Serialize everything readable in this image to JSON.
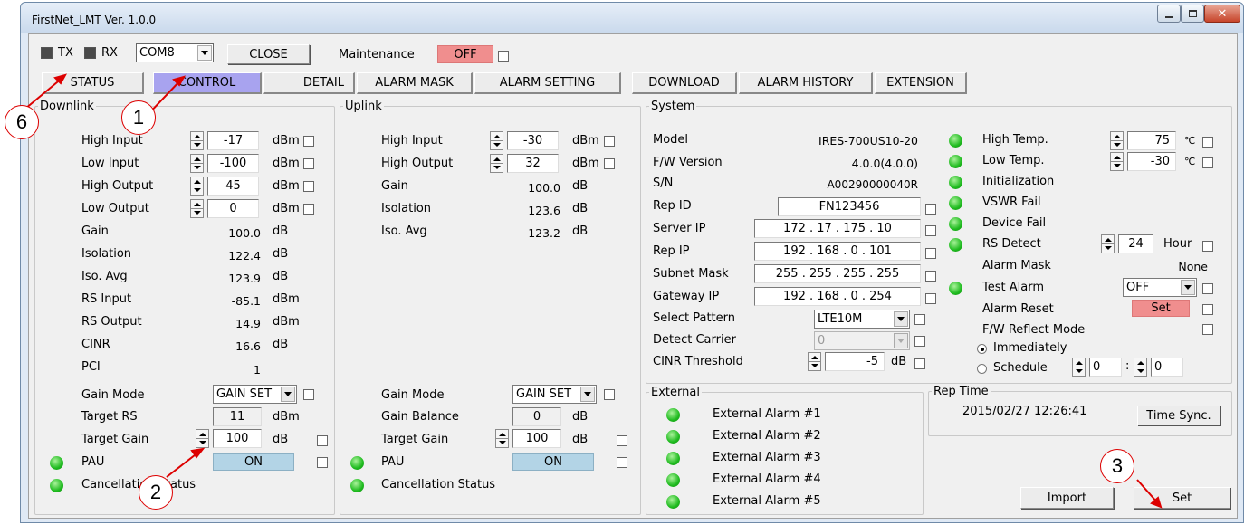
{
  "window": {
    "title": "FirstNet_LMT Ver. 1.0.0"
  },
  "toolbar": {
    "tx": "TX",
    "rx": "RX",
    "com_port": "COM8",
    "close_label": "CLOSE",
    "maintenance_label": "Maintenance",
    "maintenance_state": "OFF"
  },
  "tabs": [
    {
      "label": "STATUS"
    },
    {
      "label": "CONTROL"
    },
    {
      "label": "DETAIL"
    },
    {
      "label": "ALARM MASK"
    },
    {
      "label": "ALARM SETTING"
    },
    {
      "label": "DOWNLOAD"
    },
    {
      "label": "ALARM HISTORY"
    },
    {
      "label": "EXTENSION"
    }
  ],
  "downlink": {
    "title": "Downlink",
    "rows": [
      {
        "label": "High Input",
        "value": "-17",
        "unit": "dBm"
      },
      {
        "label": "Low Input",
        "value": "-100",
        "unit": "dBm"
      },
      {
        "label": "High Output",
        "value": "45",
        "unit": "dBm"
      },
      {
        "label": "Low Output",
        "value": "0",
        "unit": "dBm"
      }
    ],
    "readings": [
      {
        "label": "Gain",
        "value": "100.0",
        "unit": "dB"
      },
      {
        "label": "Isolation",
        "value": "122.4",
        "unit": "dB"
      },
      {
        "label": "Iso. Avg",
        "value": "123.9",
        "unit": "dB"
      },
      {
        "label": "RS Input",
        "value": "-85.1",
        "unit": "dBm"
      },
      {
        "label": "RS Output",
        "value": "14.9",
        "unit": "dBm"
      },
      {
        "label": "CINR",
        "value": "16.6",
        "unit": "dB"
      },
      {
        "label": "PCI",
        "value": "1",
        "unit": ""
      }
    ],
    "gain_mode_label": "Gain Mode",
    "gain_mode": "GAIN SET",
    "target_rs_label": "Target RS",
    "target_rs": "11",
    "target_rs_unit": "dBm",
    "target_gain_label": "Target Gain",
    "target_gain": "100",
    "target_gain_unit": "dB",
    "pau_label": "PAU",
    "pau_state": "ON",
    "cancellation_label": "Cancellation Status"
  },
  "uplink": {
    "title": "Uplink",
    "rows": [
      {
        "label": "High Input",
        "value": "-30",
        "unit": "dBm"
      },
      {
        "label": "High Output",
        "value": "32",
        "unit": "dBm"
      }
    ],
    "readings": [
      {
        "label": "Gain",
        "value": "100.0",
        "unit": "dB"
      },
      {
        "label": "Isolation",
        "value": "123.6",
        "unit": "dB"
      },
      {
        "label": "Iso. Avg",
        "value": "123.2",
        "unit": "dB"
      }
    ],
    "gain_mode_label": "Gain Mode",
    "gain_mode": "GAIN SET",
    "gain_balance_label": "Gain Balance",
    "gain_balance": "0",
    "gain_balance_unit": "dB",
    "target_gain_label": "Target Gain",
    "target_gain": "100",
    "target_gain_unit": "dB",
    "pau_label": "PAU",
    "pau_state": "ON",
    "cancellation_label": "Cancellation Status"
  },
  "system": {
    "title": "System",
    "model_label": "Model",
    "model": "IRES-700US10-20",
    "fw_label": "F/W Version",
    "fw": "4.0.0(4.0.0)",
    "sn_label": "S/N",
    "sn": "A00290000040R",
    "repid_label": "Rep ID",
    "repid": "FN123456",
    "server_ip_label": "Server IP",
    "server_ip": "172 . 17 . 175 . 10",
    "rep_ip_label": "Rep IP",
    "rep_ip": "192 . 168 .  0  . 101",
    "subnet_label": "Subnet Mask",
    "subnet": "255 . 255 . 255 . 255",
    "gateway_label": "Gateway IP",
    "gateway": "192 . 168 .  0  . 254",
    "pattern_label": "Select Pattern",
    "pattern": "LTE10M",
    "detect_label": "Detect Carrier",
    "detect": "0",
    "cinr_label": "CINR Threshold",
    "cinr": "-5",
    "cinr_unit": "dB"
  },
  "alarms": {
    "high_temp_label": "High Temp.",
    "high_temp": "75",
    "low_temp_label": "Low Temp.",
    "low_temp": "-30",
    "temp_unit": "℃",
    "init_label": "Initialization",
    "vswr_label": "VSWR Fail",
    "device_label": "Device Fail",
    "rs_detect_label": "RS Detect",
    "rs_detect": "24",
    "rs_detect_unit": "Hour",
    "alarm_mask_label": "Alarm Mask",
    "alarm_mask": "None",
    "test_alarm_label": "Test Alarm",
    "test_alarm": "OFF",
    "alarm_reset_label": "Alarm Reset",
    "set_label": "Set",
    "fw_reflect_label": "F/W Reflect Mode",
    "immediately_label": "Immediately",
    "schedule_label": "Schedule",
    "schedule_h": "0",
    "schedule_sep": ":",
    "schedule_m": "0"
  },
  "external": {
    "title": "External",
    "items": [
      "External Alarm #1",
      "External Alarm #2",
      "External Alarm #3",
      "External Alarm #4",
      "External Alarm #5"
    ]
  },
  "reptime": {
    "title": "Rep Time",
    "value": "2015/02/27 12:26:41",
    "sync_label": "Time Sync."
  },
  "footer": {
    "import_label": "Import",
    "set_label": "Set"
  },
  "callouts": [
    "6",
    "1",
    "2",
    "3"
  ]
}
